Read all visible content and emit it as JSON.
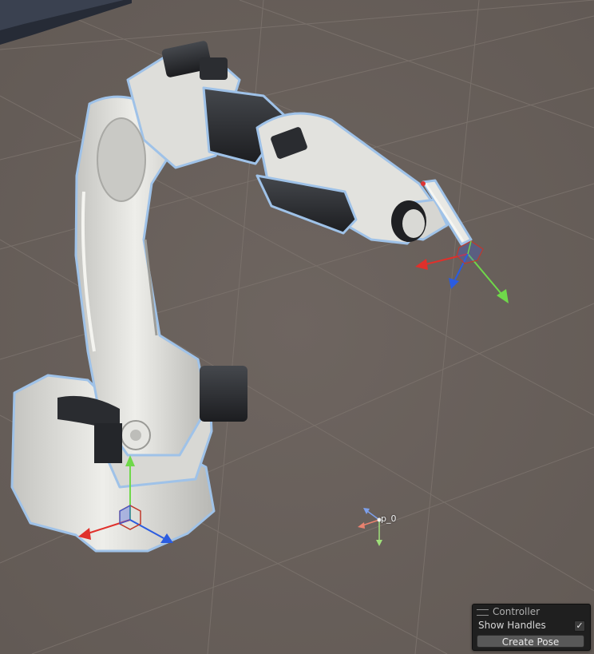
{
  "scene": {
    "object": "industrial-robot-arm",
    "colors": {
      "ground": "#6b625d",
      "grid_line": "#7a716b",
      "robot_body": "#dcdcd8",
      "robot_dark": "#2d2f33",
      "selection_outline": "#9fc2e8",
      "axis_x": "#e0302b",
      "axis_y": "#6fd84a",
      "axis_z": "#2b5ce0"
    },
    "pose_marker_label": "p_0"
  },
  "overlay": {
    "title": "Controller",
    "show_handles_label": "Show Handles",
    "show_handles_checked": true,
    "show_handles_check_glyph": "✓",
    "create_pose_label": "Create Pose"
  }
}
